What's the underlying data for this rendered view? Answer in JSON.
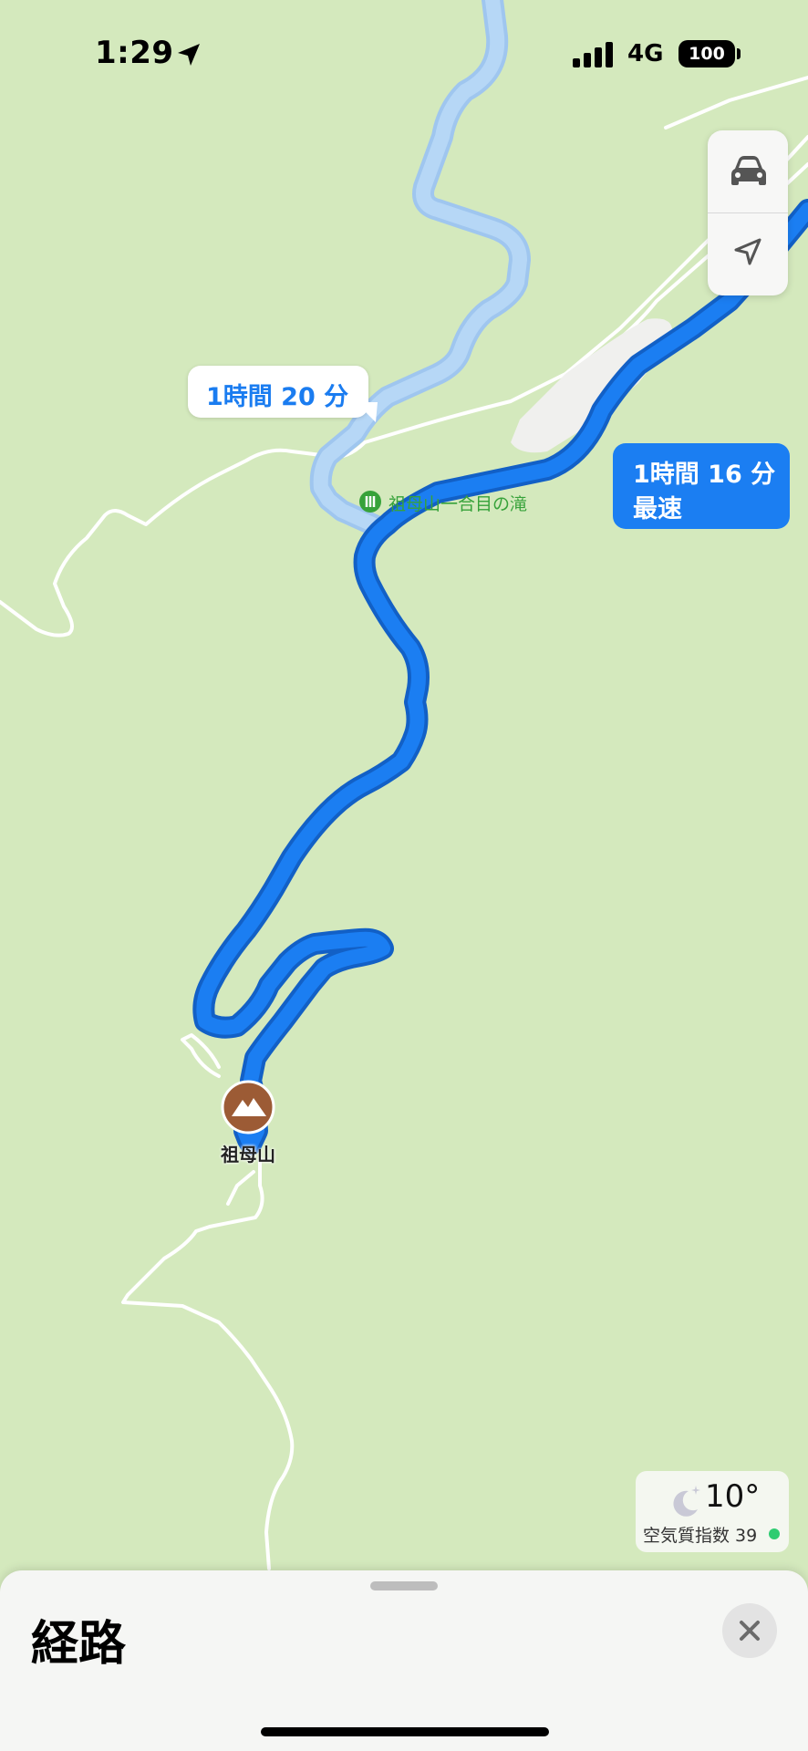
{
  "status_bar": {
    "time": "1:29",
    "network": "4G",
    "battery": "100"
  },
  "map": {
    "route_alt_time": "1時間 20 分",
    "route_main_time": "1時間 16 分",
    "route_main_tag": "最速",
    "poi_label": "祖母山一合目の滝",
    "destination_label": "祖母山",
    "colors": {
      "route_main": "#1b7ef2",
      "route_alt": "#a9cdf6",
      "land": "#d4e9bd",
      "poi": "#37a23a",
      "destination_pin": "#9c5b35"
    }
  },
  "map_controls": {
    "transport_icon": "car-icon",
    "location_icon": "location-arrow-icon"
  },
  "weather": {
    "icon": "moon-stars-icon",
    "temperature": "10°",
    "aqi_label": "空気質指数 39"
  },
  "sheet": {
    "title": "経路",
    "close_icon": "close-icon"
  }
}
